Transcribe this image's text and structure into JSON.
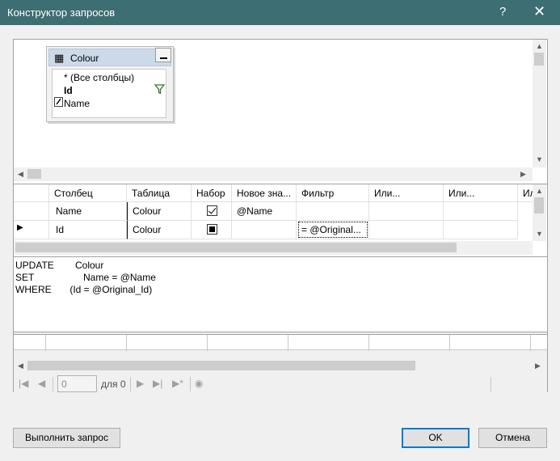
{
  "window": {
    "title": "Конструктор запросов",
    "help_glyph": "?",
    "close_glyph": "✕"
  },
  "diagram": {
    "table": {
      "name": "Colour",
      "icon": "table-icon",
      "columns": [
        {
          "label": "* (Все столбцы)",
          "bold": false
        },
        {
          "label": "Id",
          "bold": true,
          "icon": "filter-icon"
        },
        {
          "label": "Name",
          "bold": false,
          "icon": "pencil-icon"
        }
      ]
    }
  },
  "grid": {
    "headers": [
      "Столбец",
      "Таблица",
      "Набор",
      "Новое зна...",
      "Фильтр",
      "Или...",
      "Или...",
      "Ил"
    ],
    "rows": [
      {
        "column": "Name",
        "table": "Colour",
        "set": "checked",
        "new_value": "@Name",
        "filter": "",
        "or1": "",
        "or2": ""
      },
      {
        "column": "Id",
        "table": "Colour",
        "set": "indeterminate",
        "new_value": "",
        "filter": "= @Original...",
        "or1": "",
        "or2": ""
      }
    ],
    "current_row_marker": "▶"
  },
  "sql": {
    "lines": [
      {
        "keyword": "UPDATE",
        "text": "   Colour"
      },
      {
        "keyword": "SET",
        "text": "      Name = @Name"
      },
      {
        "keyword": "WHERE",
        "text": " (Id = @Original_Id)"
      }
    ]
  },
  "navigator": {
    "position": "0",
    "of_label": "для 0"
  },
  "buttons": {
    "execute": "Выполнить запрос",
    "ok": "OK",
    "cancel": "Отмена"
  },
  "colors": {
    "titlebar": "#3c6e73",
    "default_button_border": "#0078d7"
  }
}
